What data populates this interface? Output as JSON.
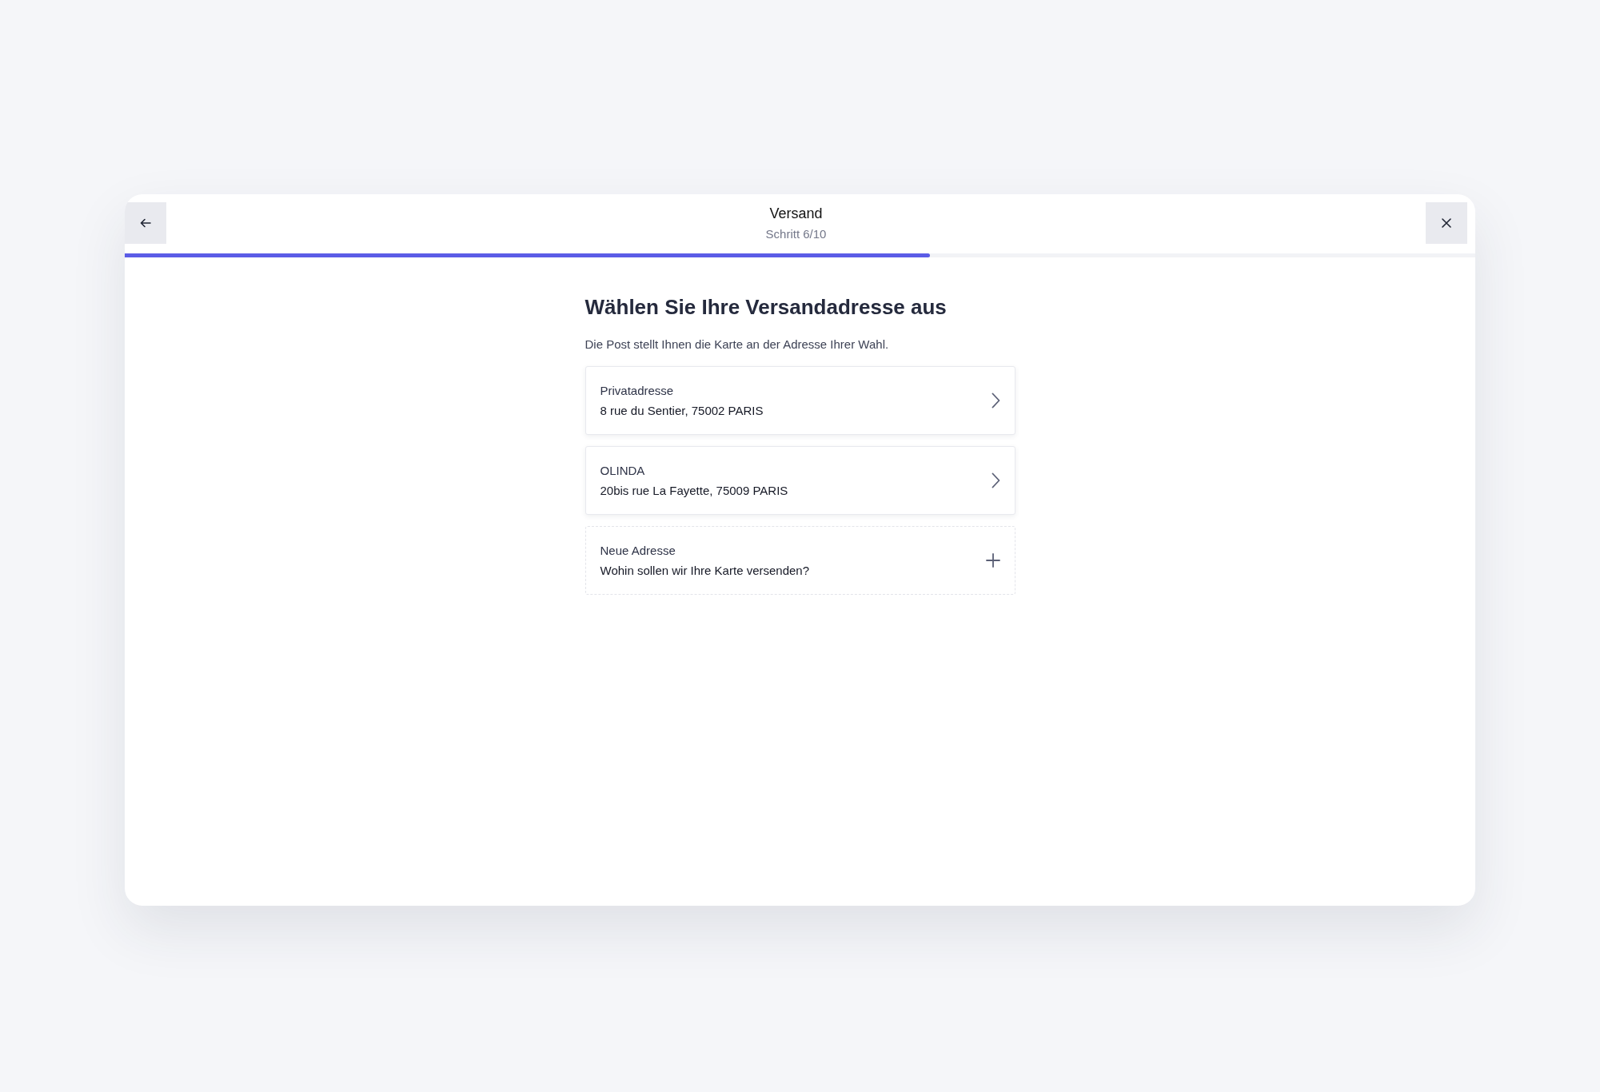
{
  "header": {
    "title": "Versand",
    "step": "Schritt 6/10"
  },
  "progress": {
    "level": 0.596
  },
  "heading": "Wählen Sie Ihre Versandadresse aus",
  "description": "Die Post stellt Ihnen die Karte an der Adresse Ihrer Wahl.",
  "options": [
    {
      "kind": "address",
      "title": "Privatadresse",
      "detail": "8 rue du Sentier, 75002 PARIS"
    },
    {
      "kind": "address",
      "title": "OLINDA",
      "detail": "20bis rue La Fayette, 75009 PARIS"
    },
    {
      "kind": "new",
      "title": "Neue Adresse",
      "detail": "Wohin sollen wir Ihre Karte versenden?"
    }
  ]
}
